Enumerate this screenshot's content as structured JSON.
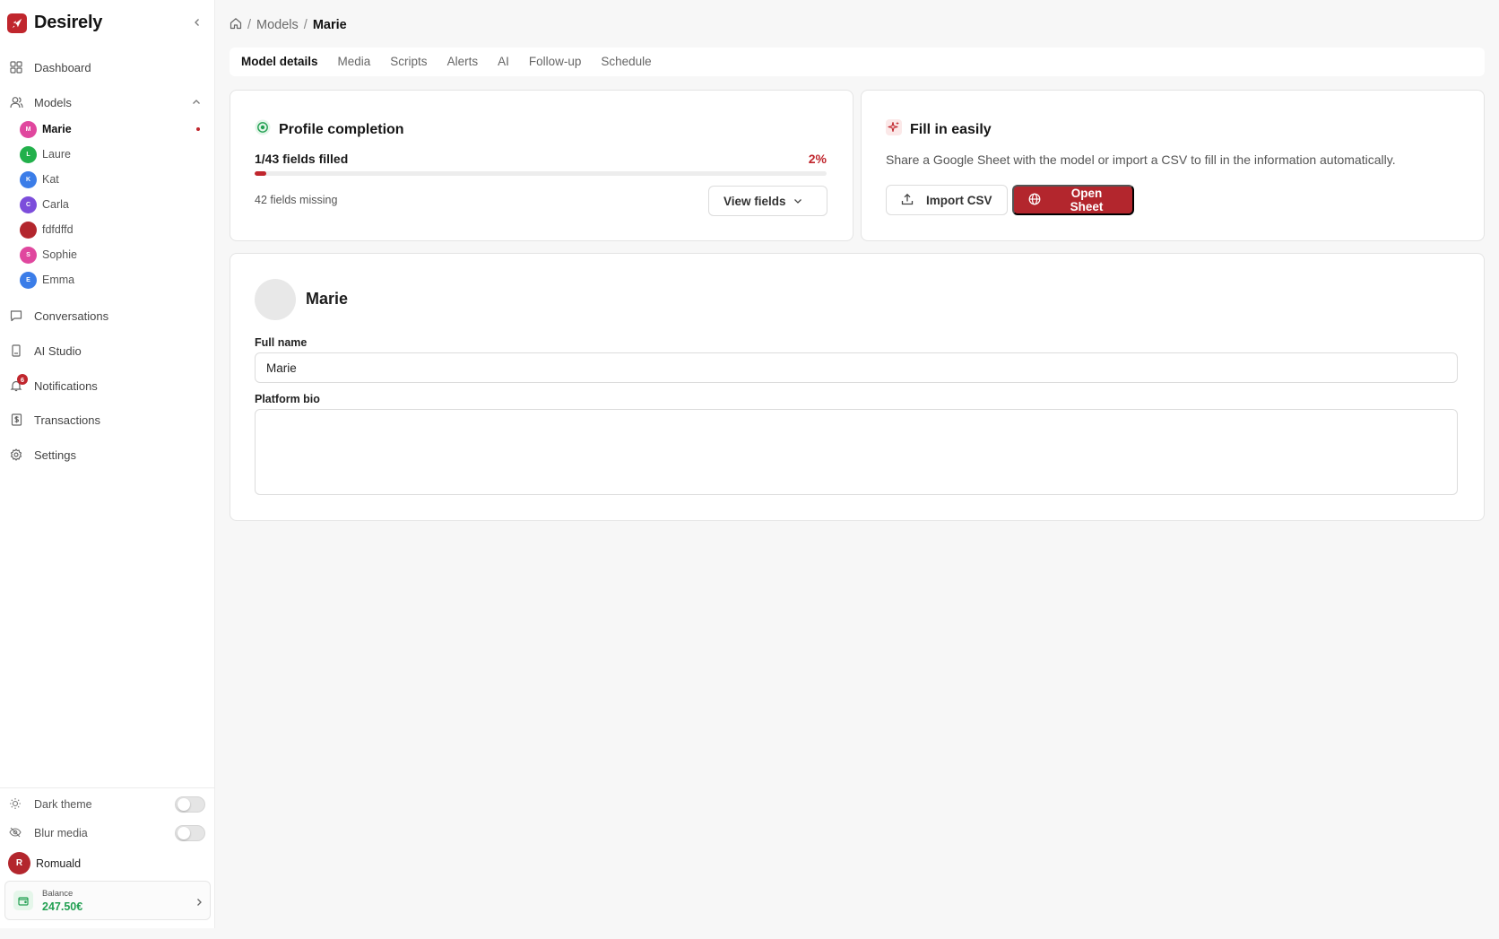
{
  "app": {
    "name": "Desirely"
  },
  "sidebar": {
    "nav": [
      {
        "label": "Dashboard"
      },
      {
        "label": "Models"
      },
      {
        "label": "Conversations"
      },
      {
        "label": "AI Studio"
      },
      {
        "label": "Notifications",
        "badge": "6"
      },
      {
        "label": "Transactions"
      },
      {
        "label": "Settings"
      }
    ],
    "models": [
      {
        "name": "Marie",
        "initial": "M",
        "color": "#e0479e",
        "active": true
      },
      {
        "name": "Laure",
        "initial": "L",
        "color": "#22b04b"
      },
      {
        "name": "Kat",
        "initial": "K",
        "color": "#3b7de8"
      },
      {
        "name": "Carla",
        "initial": "C",
        "color": "#7c4ddb"
      },
      {
        "name": "fdfdffd",
        "initial": "",
        "color": "#b3262d"
      },
      {
        "name": "Sophie",
        "initial": "S",
        "color": "#e0479e"
      },
      {
        "name": "Emma",
        "initial": "E",
        "color": "#3b7de8"
      }
    ],
    "toggles": [
      {
        "label": "Dark theme",
        "on": false
      },
      {
        "label": "Blur media",
        "on": false
      }
    ],
    "user": {
      "name": "Romuald",
      "initial": "R"
    },
    "balance": {
      "label": "Balance",
      "amount": "247.50€"
    }
  },
  "breadcrumb": {
    "section": "Models",
    "current": "Marie"
  },
  "tabs": [
    "Model details",
    "Media",
    "Scripts",
    "Alerts",
    "AI",
    "Follow-up",
    "Schedule"
  ],
  "profile_completion": {
    "title": "Profile completion",
    "fields_filled": "1/43 fields filled",
    "percent_label": "2%",
    "progress_fraction": 0.02,
    "missing": "42 fields missing",
    "view_fields_label": "View fields"
  },
  "fill_easily": {
    "title": "Fill in easily",
    "description": "Share a Google Sheet with the model or import a CSV to fill in the information automatically.",
    "import_label": "Import CSV",
    "open_label": "Open Sheet"
  },
  "model_form": {
    "name": "Marie",
    "full_name_label": "Full name",
    "full_name_value": "Marie",
    "bio_label": "Platform bio",
    "bio_value": ""
  },
  "colors": {
    "accent": "#b3262d",
    "success": "#22a052"
  }
}
